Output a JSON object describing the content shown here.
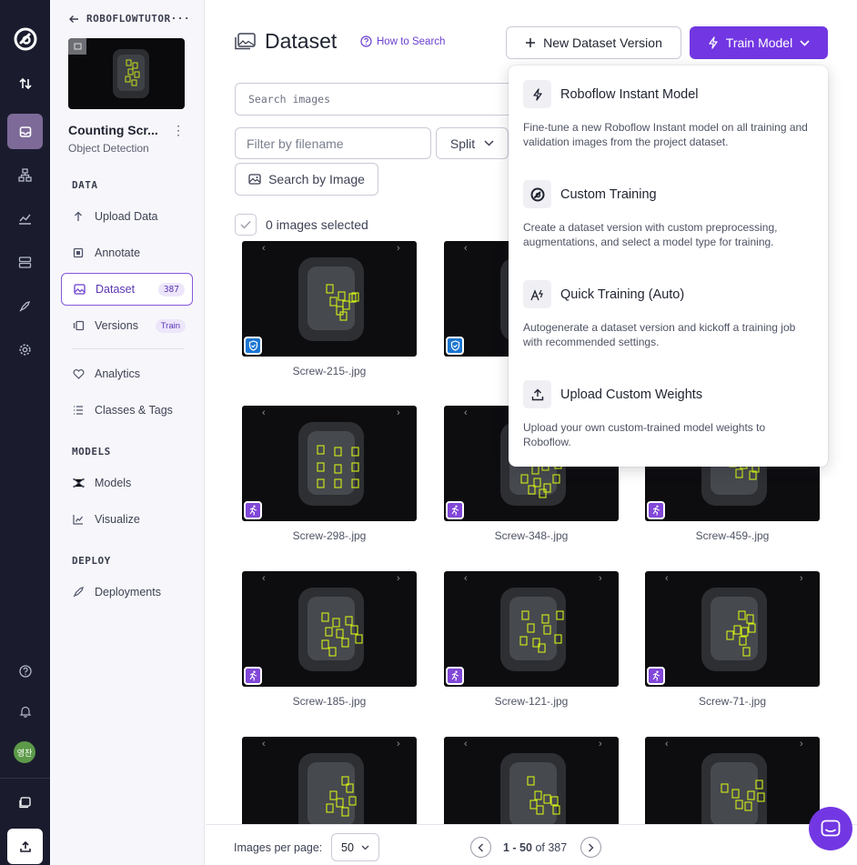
{
  "rail": {
    "items": [
      "logo",
      "transfer",
      "projects",
      "workflows",
      "analytics",
      "datasets",
      "deploy",
      "settings"
    ],
    "avatar": "영찬"
  },
  "sidebar": {
    "workspace": "ROBOFLOWTUTOR···",
    "project_name": "Counting Scr...",
    "project_type": "Object Detection",
    "sections": {
      "data": "DATA",
      "models": "MODELS",
      "deploy": "DEPLOY"
    },
    "items": {
      "upload": "Upload Data",
      "annotate": "Annotate",
      "dataset": "Dataset",
      "dataset_count": "387",
      "versions": "Versions",
      "versions_badge": "Train",
      "analytics": "Analytics",
      "classes": "Classes & Tags",
      "models": "Models",
      "visualize": "Visualize",
      "deployments": "Deployments"
    }
  },
  "header": {
    "title": "Dataset",
    "how_to_search": "How to Search",
    "new_version": "New Dataset Version",
    "train_model": "Train Model"
  },
  "filters": {
    "search_placeholder": "Search images",
    "filename_placeholder": "Filter by filename",
    "split": "Split",
    "search_by_image": "Search by Image",
    "selected": "0 images selected"
  },
  "images": [
    {
      "name": "Screw-215-.jpg",
      "badge": "verified"
    },
    {
      "name": "Scr",
      "badge": "verified"
    },
    {
      "name": "",
      "badge": "none"
    },
    {
      "name": "Screw-298-.jpg",
      "badge": "test"
    },
    {
      "name": "Screw-348-.jpg",
      "badge": "test"
    },
    {
      "name": "Screw-459-.jpg",
      "badge": "test"
    },
    {
      "name": "Screw-185-.jpg",
      "badge": "test"
    },
    {
      "name": "Screw-121-.jpg",
      "badge": "test"
    },
    {
      "name": "Screw-71-.jpg",
      "badge": "test"
    },
    {
      "name": "",
      "badge": "none"
    },
    {
      "name": "",
      "badge": "none"
    },
    {
      "name": "",
      "badge": "none"
    }
  ],
  "footer": {
    "per_page_label": "Images per page:",
    "per_page": "50",
    "range": "1 - 50",
    "of": "of 387"
  },
  "train_menu": {
    "items": [
      {
        "title": "Roboflow Instant Model",
        "desc": "Fine-tune a new Roboflow Instant model on all training and validation images from the project dataset.",
        "icon": "bolt-icon"
      },
      {
        "title": "Custom Training",
        "desc": "Create a dataset version with custom preprocessing, augmentations, and select a model type for training.",
        "icon": "roboflow-logo-icon"
      },
      {
        "title": "Quick Training (Auto)",
        "desc": "Autogenerate a dataset version and kickoff a training job with recommended settings.",
        "icon": "auto-bolt-icon"
      },
      {
        "title": "Upload Custom Weights",
        "desc": "Upload your own custom-trained model weights to Roboflow.",
        "icon": "upload-icon"
      }
    ]
  },
  "colors": {
    "accent": "#7237e2",
    "rail_bg": "#1a1c2e",
    "box": "#d4f016"
  }
}
